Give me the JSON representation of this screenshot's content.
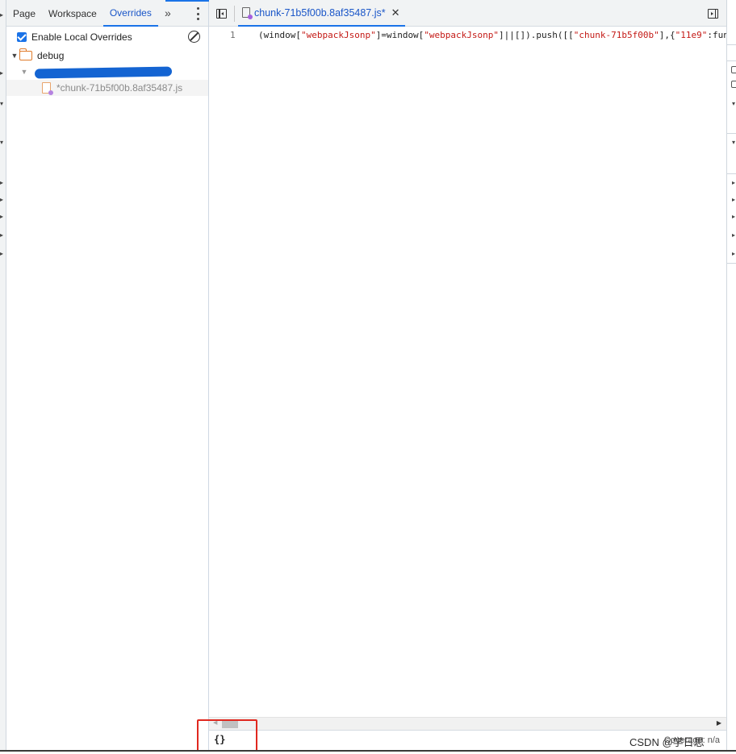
{
  "navigator": {
    "tabs": [
      {
        "label": "Page"
      },
      {
        "label": "Workspace"
      },
      {
        "label": "Overrides"
      }
    ],
    "more_tabs_label": "»",
    "enable_overrides_label": "Enable Local Overrides",
    "enable_overrides_checked": true,
    "tree": {
      "folder_name": "debug",
      "file_name": "*chunk-71b5f00b.8af35487.js"
    }
  },
  "editor": {
    "open_tab": {
      "name": "chunk-71b5f00b.8af35487.js*"
    },
    "code": {
      "line_number": "1",
      "segments": [
        {
          "text": "(window[",
          "kind": "plain"
        },
        {
          "text": "\"webpackJsonp\"",
          "kind": "string"
        },
        {
          "text": "]=window[",
          "kind": "plain"
        },
        {
          "text": "\"webpackJsonp\"",
          "kind": "string"
        },
        {
          "text": "]||[]).push([[",
          "kind": "plain"
        },
        {
          "text": "\"chunk-71b5f00b\"",
          "kind": "string"
        },
        {
          "text": "],{",
          "kind": "plain"
        },
        {
          "text": "\"11e9\"",
          "kind": "string"
        },
        {
          "text": ":fun",
          "kind": "plain"
        }
      ]
    },
    "status": {
      "pretty_print_label": "{}",
      "coverage_label": "Coverage: n/a"
    }
  },
  "watermark": "CSDN @学日思",
  "colors": {
    "accent": "#1a73e8",
    "string": "#c41a16",
    "highlight": "#e0281f",
    "folder": "#e07b2a"
  }
}
